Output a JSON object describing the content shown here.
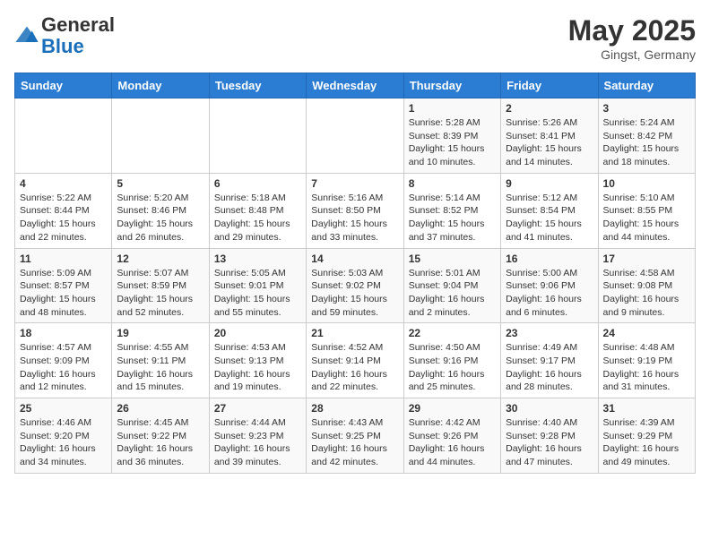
{
  "header": {
    "logo_general": "General",
    "logo_blue": "Blue",
    "month": "May 2025",
    "location": "Gingst, Germany"
  },
  "weekdays": [
    "Sunday",
    "Monday",
    "Tuesday",
    "Wednesday",
    "Thursday",
    "Friday",
    "Saturday"
  ],
  "weeks": [
    [
      {
        "day": "",
        "info": ""
      },
      {
        "day": "",
        "info": ""
      },
      {
        "day": "",
        "info": ""
      },
      {
        "day": "",
        "info": ""
      },
      {
        "day": "1",
        "info": "Sunrise: 5:28 AM\nSunset: 8:39 PM\nDaylight: 15 hours\nand 10 minutes."
      },
      {
        "day": "2",
        "info": "Sunrise: 5:26 AM\nSunset: 8:41 PM\nDaylight: 15 hours\nand 14 minutes."
      },
      {
        "day": "3",
        "info": "Sunrise: 5:24 AM\nSunset: 8:42 PM\nDaylight: 15 hours\nand 18 minutes."
      }
    ],
    [
      {
        "day": "4",
        "info": "Sunrise: 5:22 AM\nSunset: 8:44 PM\nDaylight: 15 hours\nand 22 minutes."
      },
      {
        "day": "5",
        "info": "Sunrise: 5:20 AM\nSunset: 8:46 PM\nDaylight: 15 hours\nand 26 minutes."
      },
      {
        "day": "6",
        "info": "Sunrise: 5:18 AM\nSunset: 8:48 PM\nDaylight: 15 hours\nand 29 minutes."
      },
      {
        "day": "7",
        "info": "Sunrise: 5:16 AM\nSunset: 8:50 PM\nDaylight: 15 hours\nand 33 minutes."
      },
      {
        "day": "8",
        "info": "Sunrise: 5:14 AM\nSunset: 8:52 PM\nDaylight: 15 hours\nand 37 minutes."
      },
      {
        "day": "9",
        "info": "Sunrise: 5:12 AM\nSunset: 8:54 PM\nDaylight: 15 hours\nand 41 minutes."
      },
      {
        "day": "10",
        "info": "Sunrise: 5:10 AM\nSunset: 8:55 PM\nDaylight: 15 hours\nand 44 minutes."
      }
    ],
    [
      {
        "day": "11",
        "info": "Sunrise: 5:09 AM\nSunset: 8:57 PM\nDaylight: 15 hours\nand 48 minutes."
      },
      {
        "day": "12",
        "info": "Sunrise: 5:07 AM\nSunset: 8:59 PM\nDaylight: 15 hours\nand 52 minutes."
      },
      {
        "day": "13",
        "info": "Sunrise: 5:05 AM\nSunset: 9:01 PM\nDaylight: 15 hours\nand 55 minutes."
      },
      {
        "day": "14",
        "info": "Sunrise: 5:03 AM\nSunset: 9:02 PM\nDaylight: 15 hours\nand 59 minutes."
      },
      {
        "day": "15",
        "info": "Sunrise: 5:01 AM\nSunset: 9:04 PM\nDaylight: 16 hours\nand 2 minutes."
      },
      {
        "day": "16",
        "info": "Sunrise: 5:00 AM\nSunset: 9:06 PM\nDaylight: 16 hours\nand 6 minutes."
      },
      {
        "day": "17",
        "info": "Sunrise: 4:58 AM\nSunset: 9:08 PM\nDaylight: 16 hours\nand 9 minutes."
      }
    ],
    [
      {
        "day": "18",
        "info": "Sunrise: 4:57 AM\nSunset: 9:09 PM\nDaylight: 16 hours\nand 12 minutes."
      },
      {
        "day": "19",
        "info": "Sunrise: 4:55 AM\nSunset: 9:11 PM\nDaylight: 16 hours\nand 15 minutes."
      },
      {
        "day": "20",
        "info": "Sunrise: 4:53 AM\nSunset: 9:13 PM\nDaylight: 16 hours\nand 19 minutes."
      },
      {
        "day": "21",
        "info": "Sunrise: 4:52 AM\nSunset: 9:14 PM\nDaylight: 16 hours\nand 22 minutes."
      },
      {
        "day": "22",
        "info": "Sunrise: 4:50 AM\nSunset: 9:16 PM\nDaylight: 16 hours\nand 25 minutes."
      },
      {
        "day": "23",
        "info": "Sunrise: 4:49 AM\nSunset: 9:17 PM\nDaylight: 16 hours\nand 28 minutes."
      },
      {
        "day": "24",
        "info": "Sunrise: 4:48 AM\nSunset: 9:19 PM\nDaylight: 16 hours\nand 31 minutes."
      }
    ],
    [
      {
        "day": "25",
        "info": "Sunrise: 4:46 AM\nSunset: 9:20 PM\nDaylight: 16 hours\nand 34 minutes."
      },
      {
        "day": "26",
        "info": "Sunrise: 4:45 AM\nSunset: 9:22 PM\nDaylight: 16 hours\nand 36 minutes."
      },
      {
        "day": "27",
        "info": "Sunrise: 4:44 AM\nSunset: 9:23 PM\nDaylight: 16 hours\nand 39 minutes."
      },
      {
        "day": "28",
        "info": "Sunrise: 4:43 AM\nSunset: 9:25 PM\nDaylight: 16 hours\nand 42 minutes."
      },
      {
        "day": "29",
        "info": "Sunrise: 4:42 AM\nSunset: 9:26 PM\nDaylight: 16 hours\nand 44 minutes."
      },
      {
        "day": "30",
        "info": "Sunrise: 4:40 AM\nSunset: 9:28 PM\nDaylight: 16 hours\nand 47 minutes."
      },
      {
        "day": "31",
        "info": "Sunrise: 4:39 AM\nSunset: 9:29 PM\nDaylight: 16 hours\nand 49 minutes."
      }
    ]
  ]
}
